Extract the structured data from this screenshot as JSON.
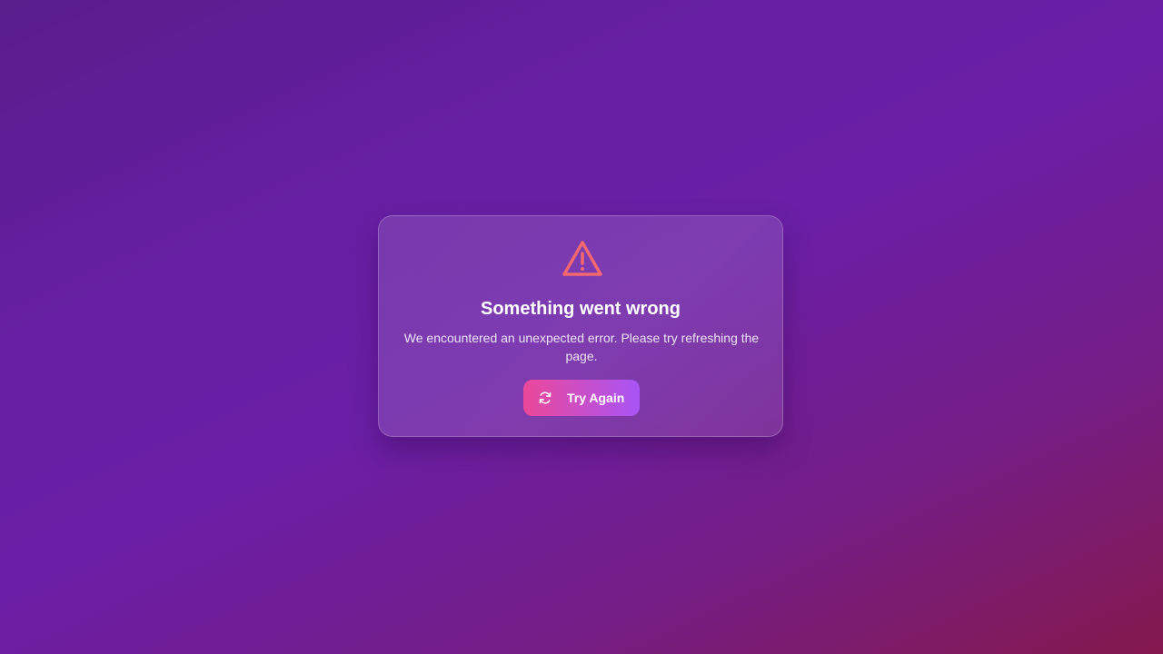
{
  "error": {
    "icon": "warning-triangle-icon",
    "title": "Something went wrong",
    "message": "We encountered an unexpected error. Please try refreshing the page.",
    "retry_icon": "refresh-icon",
    "retry_label": "Try Again"
  },
  "colors": {
    "icon": "#f4686f",
    "button_start": "#ec4899",
    "button_end": "#a855f7"
  }
}
